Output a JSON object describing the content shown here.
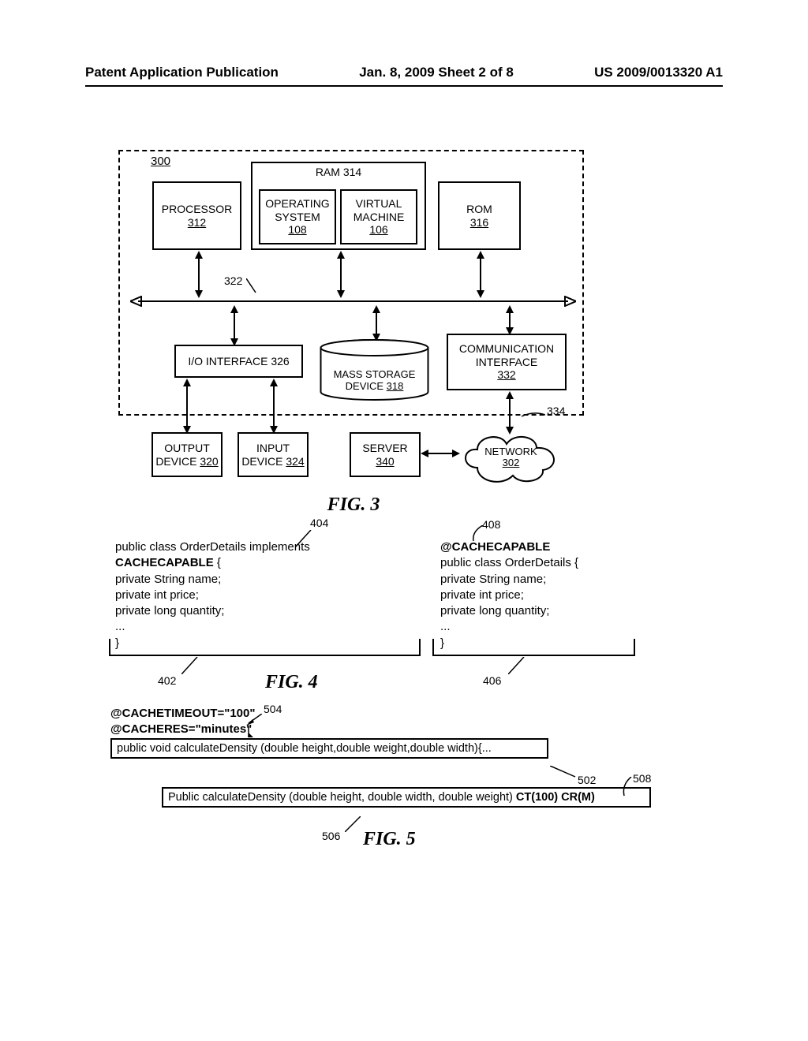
{
  "header": {
    "left": "Patent Application Publication",
    "center": "Jan. 8, 2009   Sheet 2 of 8",
    "right": "US 2009/0013320 A1"
  },
  "fig3": {
    "label": "FIG. 3",
    "ref300": "300",
    "processor": {
      "line1": "PROCESSOR",
      "line2": "312"
    },
    "ram_outer": "RAM 314",
    "os": {
      "line1": "OPERATING",
      "line2": "SYSTEM",
      "line3": "108"
    },
    "vm": {
      "line1": "VIRTUAL",
      "line2": "MACHINE",
      "line3": "106"
    },
    "rom": {
      "line1": "ROM",
      "line2": "316"
    },
    "bus_label": "322",
    "io": "I/O INTERFACE 326",
    "mass_storage": {
      "line1": "MASS STORAGE",
      "line2": "DEVICE 318"
    },
    "comm": {
      "line1": "COMMUNICATION",
      "line2": "INTERFACE",
      "line3": "332"
    },
    "output": {
      "line1": "OUTPUT",
      "line2": "DEVICE 320"
    },
    "input": {
      "line1": "INPUT",
      "line2": "DEVICE 324"
    },
    "server": {
      "line1": "SERVER",
      "line2": "340"
    },
    "network": {
      "line1": "NETWORK",
      "line2": "302"
    },
    "ref334": "334"
  },
  "fig4": {
    "label": "FIG. 4",
    "lead404": "404",
    "lead408": "408",
    "lead402": "402",
    "lead406": "406",
    "code_left": [
      "public class OrderDetails implements CACHECAPABLE {",
      "private String name;",
      "private int price;",
      "private long quantity;",
      "...",
      "}"
    ],
    "code_left_bold": "CACHECAPABLE",
    "code_right": [
      "@CACHECAPABLE",
      "public class OrderDetails {",
      "private String name;",
      "private int price;",
      "private long quantity;",
      "...",
      "}"
    ],
    "code_right_bold": "@CACHECAPABLE"
  },
  "fig5": {
    "label": "FIG. 5",
    "lead504": "504",
    "lead502": "502",
    "lead508": "508",
    "lead506": "506",
    "top_annot1": "@CACHETIMEOUT=\"100\"",
    "top_annot2": "@CACHERES=\"minutes\"",
    "top_box": "public void calculateDensity (double height,double weight,double width){...",
    "bot_box": "Public calculateDensity (double height, double width, double weight) CT(100) CR(M)"
  }
}
